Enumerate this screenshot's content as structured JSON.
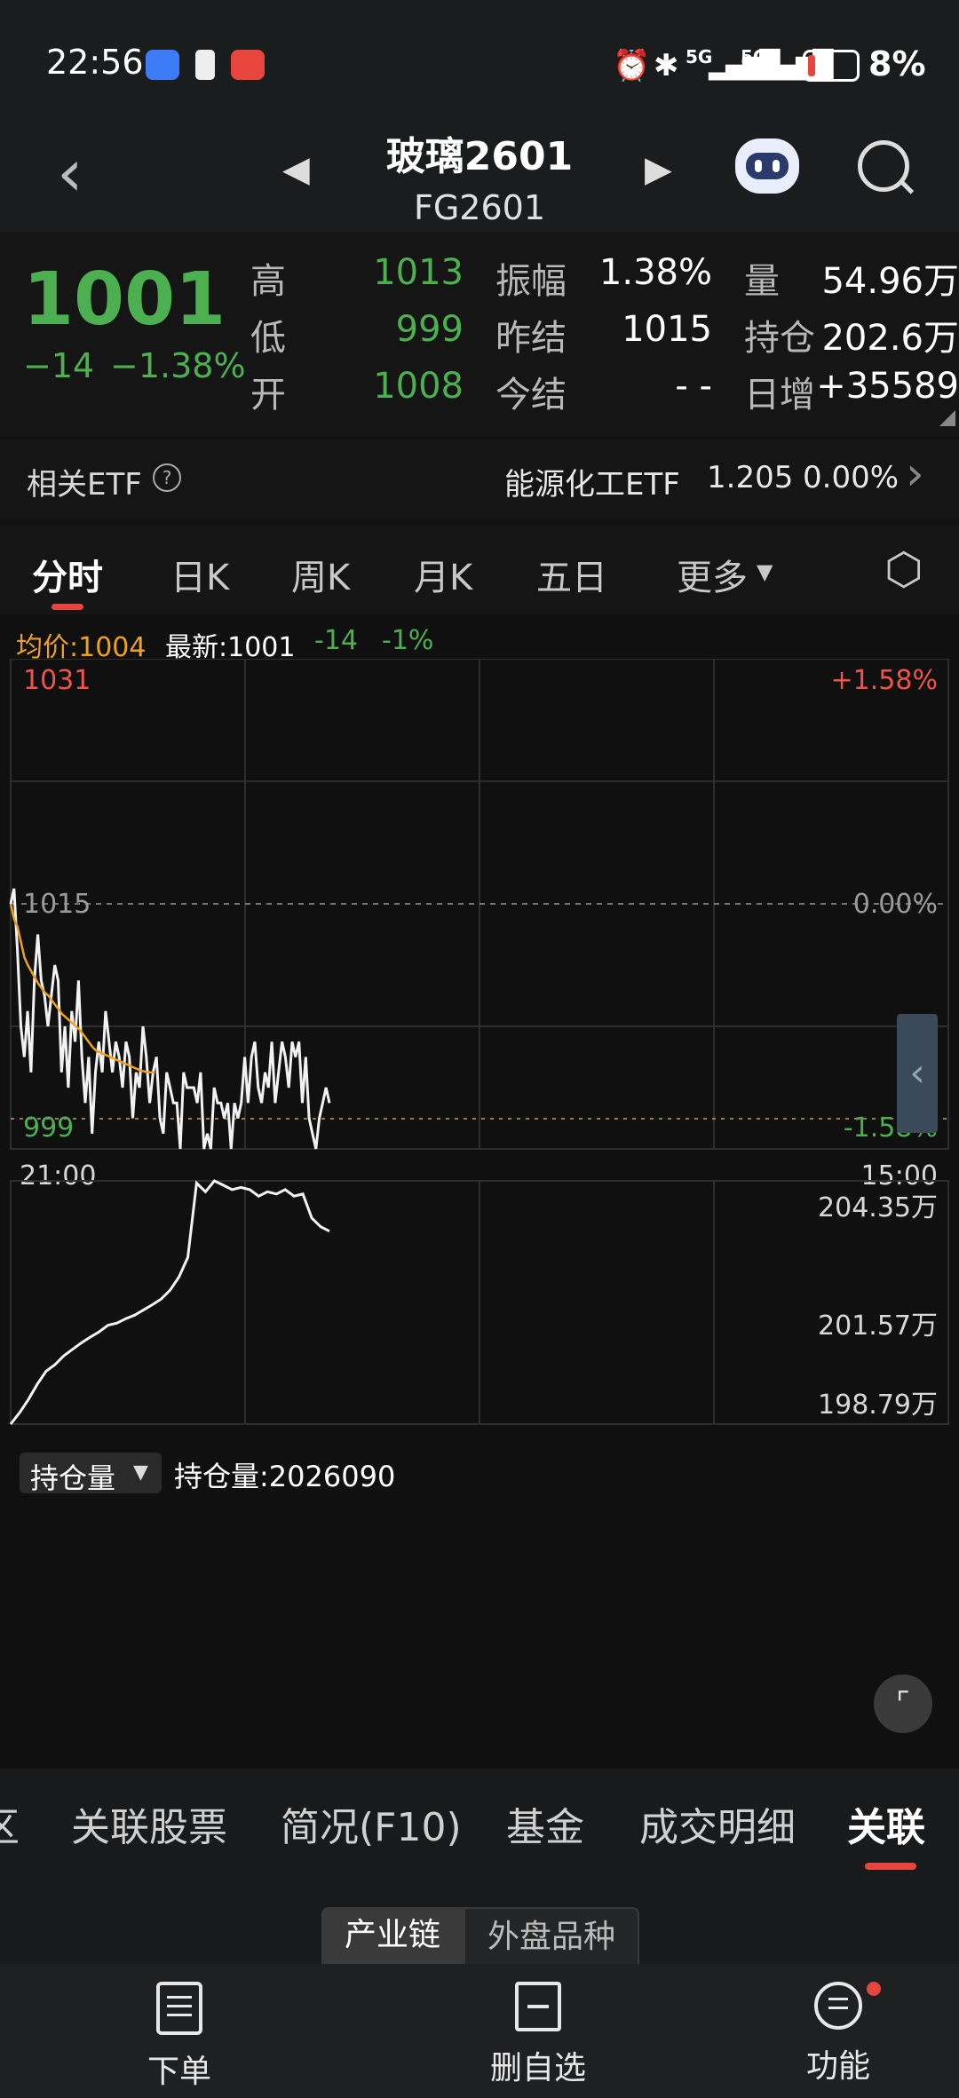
{
  "status": {
    "time": "22:56",
    "battery": "8%",
    "net1": "5G",
    "net2": "5G"
  },
  "header": {
    "name": "玻璃2601",
    "code": "FG2601"
  },
  "quote": {
    "price": "1001",
    "change": "−14",
    "change_pct": "−1.38%",
    "high_label": "高",
    "high": "1013",
    "low_label": "低",
    "low": "999",
    "open_label": "开",
    "open": "1008",
    "amp_label": "振幅",
    "amp": "1.38%",
    "prev_label": "昨结",
    "prev": "1015",
    "settle_label": "今结",
    "settle": "- -",
    "vol_label": "量",
    "vol": "54.96万",
    "oi_label": "持仓",
    "oi": "202.6万",
    "day_label": "日增",
    "day": "+35589"
  },
  "etf": {
    "label": "相关ETF",
    "name": "能源化工ETF",
    "price": "1.205",
    "pct": "0.00%"
  },
  "tabs": [
    "分时",
    "日K",
    "周K",
    "月K",
    "五日",
    "更多"
  ],
  "chart_info": {
    "avg": "均价:1004",
    "latest": "最新:1001",
    "chg": "-14",
    "pct": "-1%"
  },
  "chart_data": [
    {
      "type": "line",
      "ylim": [
        999,
        1031
      ],
      "y_ticks_left": [
        "1031",
        "1015",
        "999"
      ],
      "y_ticks_right": [
        "+1.58%",
        "0.00%",
        "-1.58%"
      ],
      "x_ticks": [
        "21:00",
        "15:00"
      ],
      "session_fraction": 0.34,
      "series": [
        {
          "name": "价格",
          "color": "#f2f2f2",
          "values": [
            1015,
            1016,
            1012,
            1007,
            1005,
            1008,
            1004,
            1010,
            1013,
            1010,
            1009,
            1007,
            1009,
            1011,
            1010,
            1004,
            1007,
            1003,
            1008,
            1006,
            1010,
            1005,
            1002,
            1005,
            1000,
            1004,
            1006,
            1004,
            1008,
            1006,
            1004,
            1006,
            1005,
            1003,
            1006,
            1005,
            1001,
            1004,
            1003,
            1007,
            1005,
            1002,
            1004,
            1005,
            1001,
            1000,
            1004,
            1003,
            1002,
            1002,
            999,
            1004,
            1003,
            1003,
            1003,
            1002,
            1004,
            999,
            1000,
            999,
            1003,
            1002,
            1002,
            1001,
            1002,
            999,
            1002,
            1001,
            1002,
            1005,
            1002,
            1005,
            1006,
            1003,
            1002,
            1004,
            1003,
            1006,
            1002,
            1004,
            1006,
            1005,
            1003,
            1006,
            1005,
            1006,
            1002,
            1005,
            1001,
            1000,
            999,
            1001,
            1002,
            1003,
            1002
          ]
        },
        {
          "name": "均价",
          "color": "#f0a020",
          "values": [
            1015,
            1014,
            1013.5,
            1012.5,
            1011.5,
            1011,
            1010.6,
            1010.2,
            1009.8,
            1009.5,
            1009.2,
            1009,
            1008.7,
            1008.4,
            1008.1,
            1007.8,
            1007.6,
            1007.4,
            1007.2,
            1007,
            1006.8,
            1006.5,
            1006.2,
            1005.9,
            1005.6,
            1005.4,
            1005.3,
            1005.2,
            1005.1,
            1005,
            1004.9,
            1004.8,
            1004.7,
            1004.6,
            1004.5,
            1004.4,
            1004.3,
            1004.2,
            1004.1,
            1004.05,
            1004,
            1004,
            1004
          ]
        }
      ]
    },
    {
      "type": "line",
      "title": "持仓量",
      "value_label": "持仓量:2026090",
      "ylim": [
        1987900,
        2043500
      ],
      "y_ticks": [
        "204.35万",
        "201.57万",
        "198.79万"
      ],
      "series": [
        {
          "name": "持仓量",
          "color": "#f2f2f2",
          "values": [
            1987900,
            1990500,
            1993500,
            1997000,
            2000000,
            2001500,
            2003500,
            2005000,
            2006500,
            2007800,
            2009000,
            2010500,
            2011000,
            2012000,
            2012800,
            2014000,
            2015200,
            2016500,
            2018500,
            2021500,
            2026000,
            2043000,
            2041000,
            2043500,
            2042500,
            2041500,
            2042000,
            2041500,
            2040000,
            2041000,
            2040500,
            2041500,
            2040000,
            2040500,
            2035000,
            2033000,
            2032000
          ]
        }
      ]
    }
  ],
  "chart_controls": {
    "oi_select": "持仓量"
  },
  "bottom_tabs": [
    "区",
    "关联股票",
    "简况(F10)",
    "基金",
    "成交明细",
    "关联"
  ],
  "subtabs": [
    "产业链",
    "外盘品种"
  ],
  "toolbar": {
    "order": "下单",
    "delete_watch": "删自选",
    "functions": "功能"
  },
  "colors": {
    "up": "#f0534a",
    "down": "#4caf50",
    "avg": "#f0a020",
    "accent": "#e8453c"
  }
}
